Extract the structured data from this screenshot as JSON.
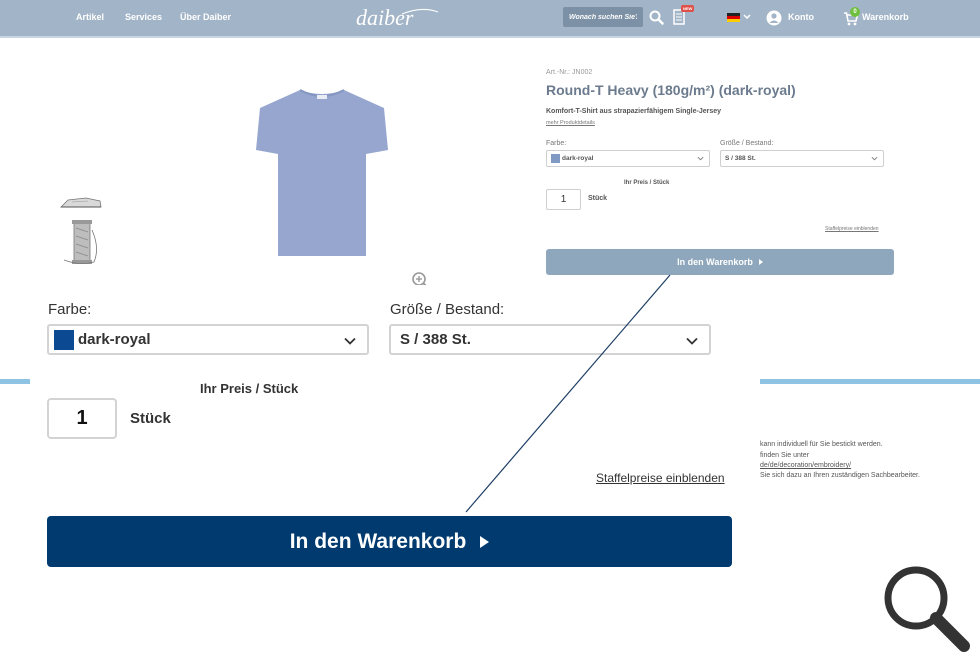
{
  "header": {
    "nav": [
      "Artikel",
      "Services",
      "Über Daiber"
    ],
    "logo_text": "daiber",
    "search_placeholder": "Wonach suchen Sie?",
    "new_badge": "NEW",
    "account_label": "Konto",
    "cart_label": "Warenkorb",
    "cart_count": "0"
  },
  "product": {
    "art_nr": "Art.-Nr.: JN002",
    "title": "Round-T Heavy (180g/m²) (dark-royal)",
    "subtitle": "Komfort-T-Shirt aus strapazierfähigem Single-Jersey",
    "details_link": "mehr Produktdetails",
    "color_label": "Farbe:",
    "color_value": "dark-royal",
    "size_label": "Größe / Bestand:",
    "size_value": "S / 388 St.",
    "price_label": "Ihr Preis / Stück",
    "quantity": "1",
    "unit": "Stück",
    "staffel_link": "Staffelpreise einblenden",
    "cart_button": "In den Warenkorb"
  },
  "side_text": [
    "kann individuell für Sie bestickt werden.",
    "finden Sie unter",
    "de/de/decoration/embroidery/",
    "Sie sich dazu an Ihren zuständigen Sachbearbeiter."
  ],
  "colors": {
    "header_bg": "#a2b4c7",
    "cart_button_dark": "#003a6e",
    "cart_button_light": "#8ea7bc",
    "swatch_dark_royal": "#0b4a93",
    "tshirt": "#96a6cf"
  }
}
